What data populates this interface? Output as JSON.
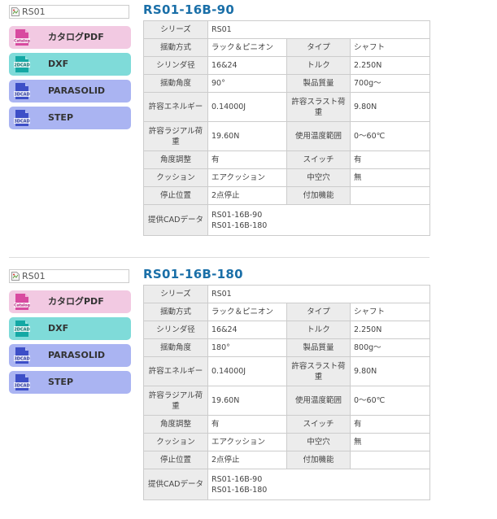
{
  "colors": {
    "title": "#1a6fa8",
    "catalog_button": "#f2c9e2",
    "dxf_button": "#7fdbd9",
    "cad3d_button": "#aab4f2",
    "key_cell": "#ececec",
    "border": "#cccccc"
  },
  "buttons": {
    "catalog": {
      "label": "カタログPDF",
      "icon": "catalog-icon",
      "icon_text": "Catalog"
    },
    "dxf": {
      "label": "DXF",
      "icon": "2dcad-icon",
      "icon_text": "2DCAD"
    },
    "parasolid": {
      "label": "PARASOLID",
      "icon": "3dcad-icon",
      "icon_text": "3DCAD"
    },
    "step": {
      "label": "STEP",
      "icon": "3dcad-icon",
      "icon_text": "3DCAD"
    }
  },
  "products": [
    {
      "image_alt": "RS01",
      "title": "RS01-16B-90",
      "series_label": "シリーズ",
      "series_value": "RS01",
      "rows": [
        {
          "k1": "揺動方式",
          "v1": "ラック＆ピニオン",
          "k2": "タイプ",
          "v2": "シャフト"
        },
        {
          "k1": "シリンダ径",
          "v1": "16&24",
          "k2": "トルク",
          "v2": "2.250N"
        },
        {
          "k1": "揺動角度",
          "v1": "90°",
          "k2": "製品質量",
          "v2": "700g～"
        },
        {
          "k1": "許容エネルギー",
          "v1": "0.14000J",
          "k2": "許容スラスト荷重",
          "v2": "9.80N"
        },
        {
          "k1": "許容ラジアル荷重",
          "v1": "19.60N",
          "k2": "使用温度範囲",
          "v2": "0～60℃"
        },
        {
          "k1": "角度調整",
          "v1": "有",
          "k2": "スイッチ",
          "v2": "有"
        },
        {
          "k1": "クッション",
          "v1": "エアクッション",
          "k2": "中空穴",
          "v2": "無"
        },
        {
          "k1": "停止位置",
          "v1": "2点停止",
          "k2": "付加機能",
          "v2": ""
        }
      ],
      "cad_label": "提供CADデータ",
      "cad_files": [
        "RS01-16B-90",
        "RS01-16B-180"
      ]
    },
    {
      "image_alt": "RS01",
      "title": "RS01-16B-180",
      "series_label": "シリーズ",
      "series_value": "RS01",
      "rows": [
        {
          "k1": "揺動方式",
          "v1": "ラック＆ピニオン",
          "k2": "タイプ",
          "v2": "シャフト"
        },
        {
          "k1": "シリンダ径",
          "v1": "16&24",
          "k2": "トルク",
          "v2": "2.250N"
        },
        {
          "k1": "揺動角度",
          "v1": "180°",
          "k2": "製品質量",
          "v2": "800g～"
        },
        {
          "k1": "許容エネルギー",
          "v1": "0.14000J",
          "k2": "許容スラスト荷重",
          "v2": "9.80N"
        },
        {
          "k1": "許容ラジアル荷重",
          "v1": "19.60N",
          "k2": "使用温度範囲",
          "v2": "0～60℃"
        },
        {
          "k1": "角度調整",
          "v1": "有",
          "k2": "スイッチ",
          "v2": "有"
        },
        {
          "k1": "クッション",
          "v1": "エアクッション",
          "k2": "中空穴",
          "v2": "無"
        },
        {
          "k1": "停止位置",
          "v1": "2点停止",
          "k2": "付加機能",
          "v2": ""
        }
      ],
      "cad_label": "提供CADデータ",
      "cad_files": [
        "RS01-16B-90",
        "RS01-16B-180"
      ]
    }
  ]
}
